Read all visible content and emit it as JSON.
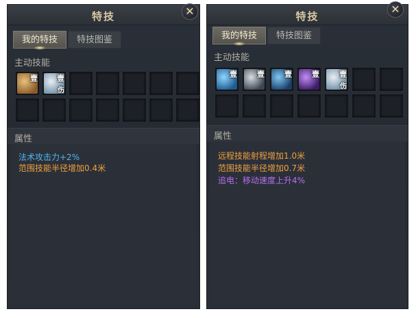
{
  "left": {
    "title": "特技",
    "close_glyph": "✕",
    "tabs": [
      {
        "label": "我的特技",
        "active": true
      },
      {
        "label": "特技图鉴",
        "active": false
      }
    ],
    "active_skills_label": "主动技能",
    "skills": [
      {
        "icon": "swirl-skill-icon",
        "rank": "壹",
        "sub": "",
        "colors": [
          "#e7c27a",
          "#8b5a2b"
        ]
      },
      {
        "icon": "shield-skill-icon",
        "rank": "壹",
        "sub": "伤",
        "colors": [
          "#e8eef4",
          "#6f8fa6"
        ]
      }
    ],
    "attributes_label": "属性",
    "attributes": [
      {
        "text": "法术攻击力+2%",
        "color": "#4fb7f0"
      },
      {
        "text": "范围技能半径增加0.4米",
        "color": "#f0a040"
      }
    ]
  },
  "right": {
    "title": "特技",
    "close_glyph": "✕",
    "tabs": [
      {
        "label": "我的特技",
        "active": true
      },
      {
        "label": "特技图鉴",
        "active": false
      }
    ],
    "active_skills_label": "主动技能",
    "skills": [
      {
        "icon": "wave-skill-icon",
        "rank": "壹",
        "sub": "",
        "colors": [
          "#8fd6ff",
          "#1e5a8e"
        ]
      },
      {
        "icon": "blade-skill-icon",
        "rank": "壹",
        "sub": "",
        "colors": [
          "#d8dde3",
          "#3d4550"
        ]
      },
      {
        "icon": "ring-skill-icon",
        "rank": "壹",
        "sub": "",
        "colors": [
          "#7fc8f5",
          "#1b3e66"
        ]
      },
      {
        "icon": "lightning-skill-icon",
        "rank": "壹",
        "sub": "",
        "colors": [
          "#c48cf5",
          "#3b1c66"
        ]
      },
      {
        "icon": "shield-skill-icon",
        "rank": "壹",
        "sub": "伤",
        "colors": [
          "#e8eef4",
          "#6f8fa6"
        ]
      }
    ],
    "attributes_label": "属性",
    "attributes": [
      {
        "text": "远程技能射程增加1.0米",
        "color": "#f0a040"
      },
      {
        "text": "范围技能半径增加0.7米",
        "color": "#f0a040"
      },
      {
        "text": "追电：移动速度上升4%",
        "color": "#b46ef0"
      }
    ]
  }
}
